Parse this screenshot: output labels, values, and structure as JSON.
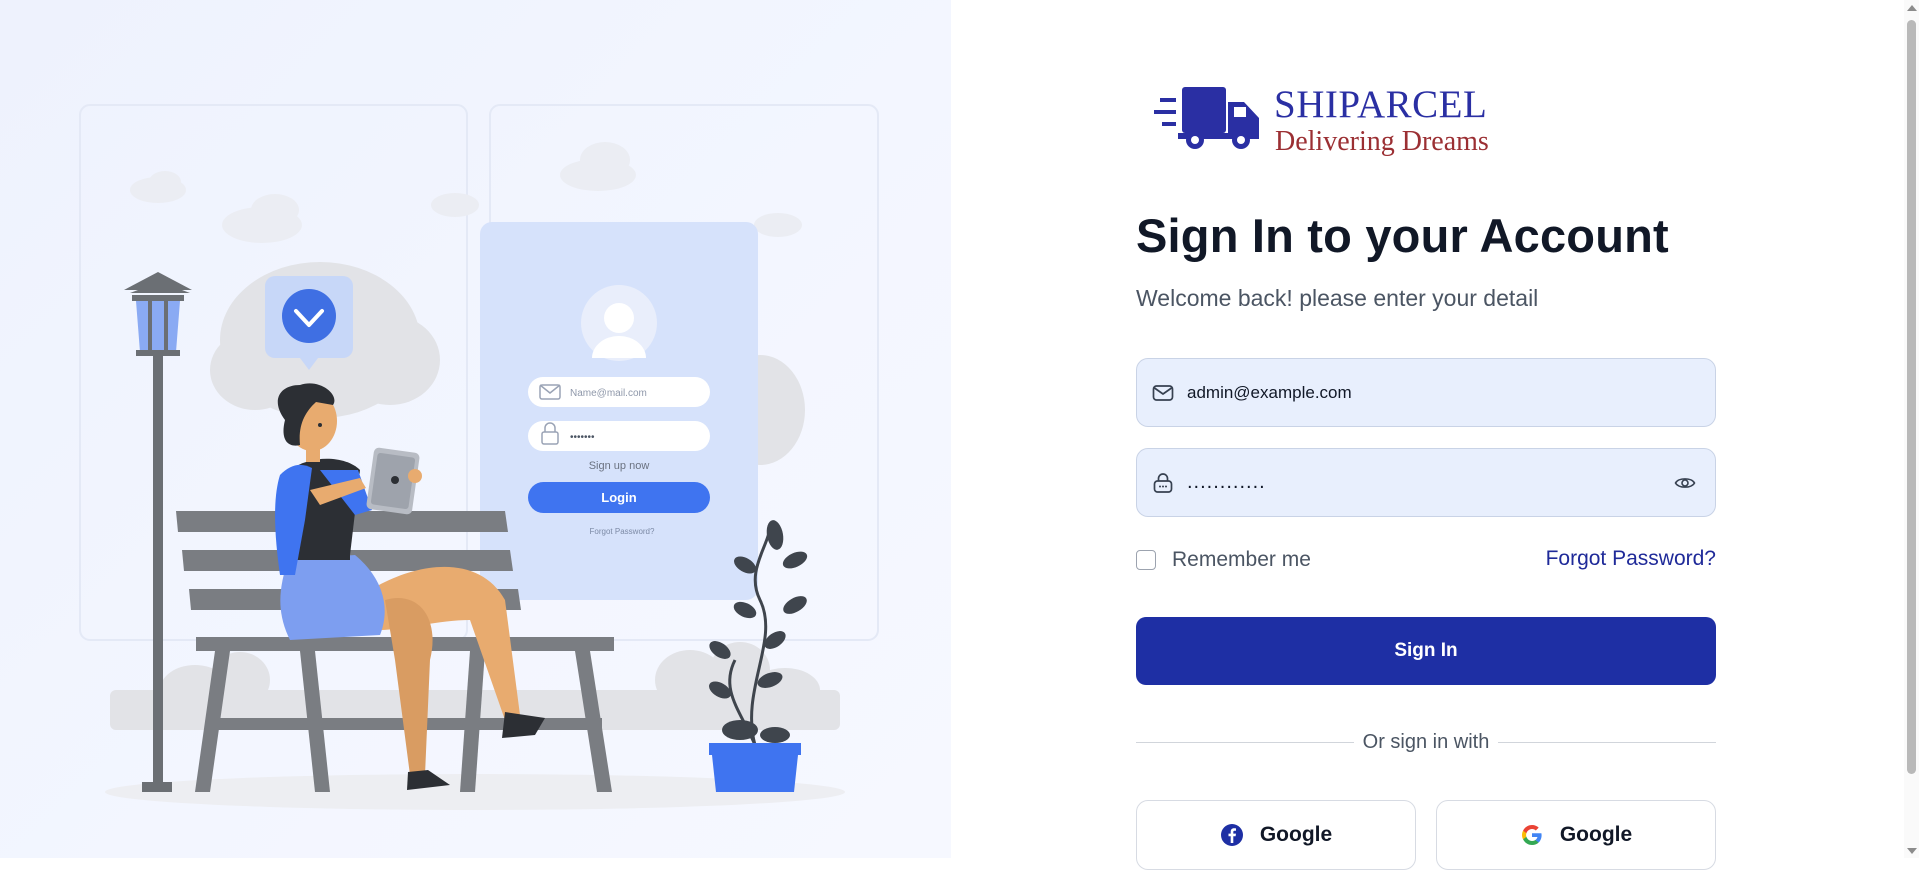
{
  "brand": {
    "name": "SHIPARCEL",
    "tagline": "Delivering Dreams",
    "primary_color": "#1e2fa4",
    "tagline_color": "#9b2f33"
  },
  "illustration": {
    "email_placeholder": "Name@mail.com",
    "password_mask": "•••••••",
    "signup_text": "Sign up now",
    "login_label": "Login",
    "forgot_text": "Forgot Password?"
  },
  "login": {
    "title": "Sign In to your Account",
    "subtitle": "Welcome back! please enter your detail",
    "email": {
      "value": "admin@example.com",
      "icon": "mail-icon"
    },
    "password": {
      "value": "............",
      "icon": "lock-icon",
      "toggle_icon": "eye-icon"
    },
    "remember_label": "Remember me",
    "forgot_label": "Forgot Password?",
    "submit_label": "Sign In",
    "divider_text": "Or sign in with",
    "social": [
      {
        "label": "Google",
        "icon": "facebook-icon"
      },
      {
        "label": "Google",
        "icon": "google-icon"
      }
    ]
  }
}
